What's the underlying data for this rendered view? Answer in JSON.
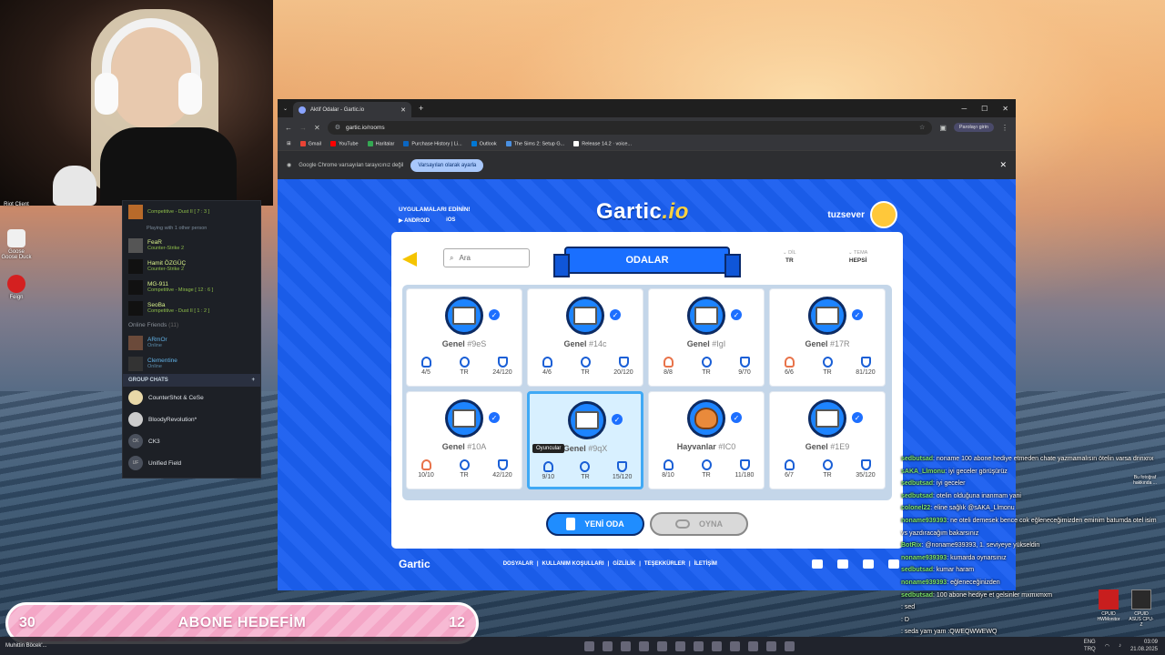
{
  "desktop": {
    "icons": [
      {
        "label": "Riot Client"
      },
      {
        "label": "Goose Goose Duck"
      },
      {
        "label": "Feign"
      }
    ],
    "bottom_right_icons": [
      {
        "label": "CPUID HWMonitor"
      },
      {
        "label": "CPUID ASUS CPU-Z"
      }
    ],
    "side_photo_label": "Bu fotoğraf hakkında ..."
  },
  "friends_panel": {
    "friends": [
      {
        "name": "",
        "status": "Competitive - Dust II [ 7 : 3 ]"
      },
      {
        "name": "",
        "status": "Playing with 1 other person"
      },
      {
        "name": "FeaR",
        "status": "Counter-Strike 2"
      },
      {
        "name": "Hamit ÖZGÜÇ",
        "status": "Counter-Strike 2"
      },
      {
        "name": "MG-911",
        "status": "Competitive - Mirage [ 12 : 6 ]"
      },
      {
        "name": "SeoBa",
        "status": "Competitive - Dust II [ 1 : 2 ]"
      }
    ],
    "online_header": "Online Friends",
    "online_count": "(11)",
    "online": [
      {
        "name": "ARmOr",
        "status": "Online"
      },
      {
        "name": "Clementine",
        "status": "Online"
      }
    ],
    "group_header": "GROUP CHATS",
    "groups": [
      {
        "name": "CounterShot & CeSe",
        "initials": ""
      },
      {
        "name": "BloodyRevolution*",
        "initials": ""
      },
      {
        "name": "CK3",
        "initials": "CK"
      },
      {
        "name": "Unified Field",
        "initials": "UF"
      }
    ]
  },
  "browser": {
    "tab_title": "Aktif Odalar - Gartic.io",
    "url": "gartic.io/rooms",
    "profile": "Parolayı girin",
    "bookmarks": [
      "Gmail",
      "YouTube",
      "Haritalar",
      "Purchase History | Li...",
      "Outlook",
      "The Sims 2: Setup G...",
      "Release 14.2 · voice..."
    ],
    "infobar_text": "Google Chrome varsayılan tarayıcınız değil",
    "infobar_button": "Varsayılan olarak ayarla"
  },
  "gartic": {
    "apps_title": "UYGULAMALARI EDİNİN!",
    "android": "ANDROID",
    "ios": "iOS",
    "logo_main": "Gartic",
    "logo_suffix": ".io",
    "username": "tuzsever",
    "search_placeholder": "Ara",
    "rooms_title": "ODALAR",
    "filter_lang_label": "DİL",
    "filter_lang_value": "TR",
    "filter_theme_label": "TEMA",
    "filter_theme_value": "HEPSİ",
    "tooltip": "Oyuncular",
    "rooms": [
      {
        "name": "Genel",
        "code": "#9eS",
        "players": "4/5",
        "lang": "TR",
        "points": "24/120",
        "full": false
      },
      {
        "name": "Genel",
        "code": "#14c",
        "players": "4/6",
        "lang": "TR",
        "points": "20/120",
        "full": false
      },
      {
        "name": "Genel",
        "code": "#IgI",
        "players": "8/8",
        "lang": "TR",
        "points": "9/70",
        "full": true
      },
      {
        "name": "Genel",
        "code": "#17R",
        "players": "6/6",
        "lang": "TR",
        "points": "81/120",
        "full": true
      },
      {
        "name": "Genel",
        "code": "#10A",
        "players": "10/10",
        "lang": "TR",
        "points": "42/120",
        "full": true
      },
      {
        "name": "Genel",
        "code": "#9qX",
        "players": "9/10",
        "lang": "TR",
        "points": "15/120",
        "full": false
      },
      {
        "name": "Hayvanlar",
        "code": "#IC0",
        "players": "8/10",
        "lang": "TR",
        "points": "11/180",
        "full": false
      },
      {
        "name": "Genel",
        "code": "#1E9",
        "players": "6/7",
        "lang": "TR",
        "points": "35/120",
        "full": false
      }
    ],
    "new_room": "YENİ ODA",
    "play": "OYNA",
    "footer_logo": "Gartic",
    "footer_links": [
      "DOSYALAR",
      "|",
      "KULLANIM KOŞULLARI",
      "|",
      "GİZLİLİK",
      "|",
      "TEŞEKKÜRLER",
      "|",
      "İLETİŞİM"
    ]
  },
  "chat": [
    {
      "user": "sedbutsad",
      "text": ": noname 100 abone hediye etmeden chate yazmamalısın ötelin varsa dnnxnx"
    },
    {
      "user": "sAKA_Llmonu",
      "text": ": iyi geceler görüşürüz"
    },
    {
      "user": "sedbutsad",
      "text": ": iyi geceler"
    },
    {
      "user": "sedbutsad",
      "text": ": otelin olduğuna inanmam yani"
    },
    {
      "user": "colonel22",
      "text": ": eline sağlık @sAKA_Llmonu"
    },
    {
      "user": "noname939393",
      "text": ": ne oteli demesek bence cok eğleneceğimizden eminim batumda otel isim vs yazdıracağım bakarsınız"
    },
    {
      "user": "BotRix",
      "text": ": @noname939393, 1. seviyeye yükseldin"
    },
    {
      "user": "noname939393",
      "text": ": kumarda oynarsınız"
    },
    {
      "user": "sedbutsad",
      "text": ": kumar haram"
    },
    {
      "user": "noname939393",
      "text": ": eğleneceğinizden"
    },
    {
      "user": "sedbutsad",
      "text": ": 100 abone hediye et gelsinler mxmxmxm"
    },
    {
      "user": "",
      "text": ": sed"
    },
    {
      "user": "",
      "text": ": D"
    },
    {
      "user": "",
      "text": ": seda yam yam :QWEQWWEWQ"
    }
  ],
  "goal_bar": {
    "left": "30",
    "label": "ABONE HEDEFİM",
    "right": "12"
  },
  "taskbar": {
    "news": "Muhittin Böcek'...",
    "lang_top": "ENG",
    "lang_bottom": "TRQ",
    "time": "03:09",
    "date": "21.08.2025"
  }
}
